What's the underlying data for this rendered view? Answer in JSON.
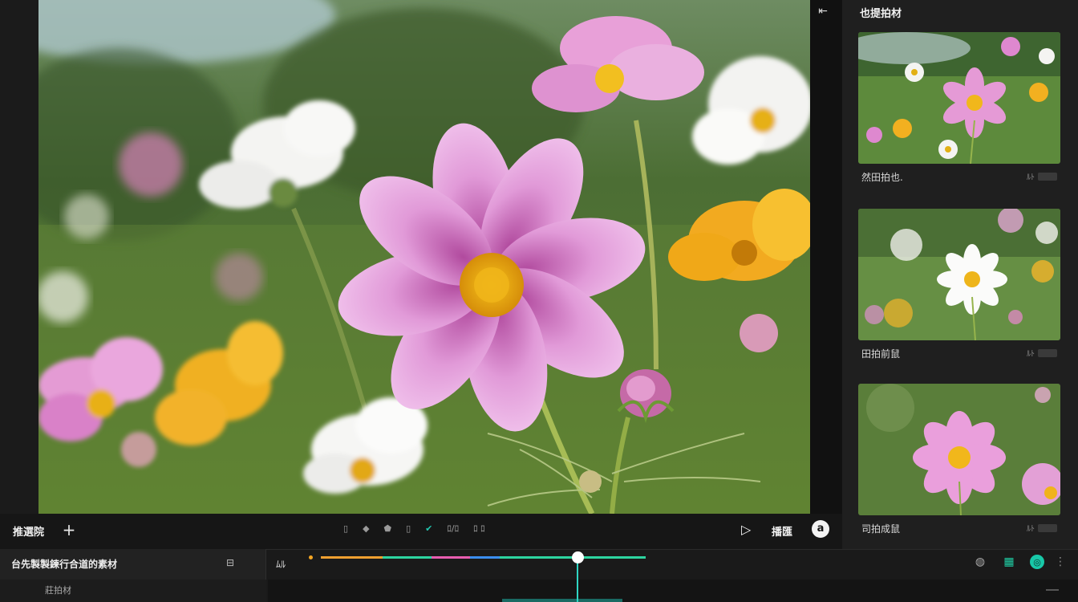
{
  "panel": {
    "title": "也提拍材",
    "collapse_icon": "collapse-icon",
    "cards": [
      {
        "label": "然田拍也.",
        "meta": "ﾙﾄ"
      },
      {
        "label": "田拍前鼠",
        "meta": "ﾙﾄ"
      },
      {
        "label": "司拍成鼠",
        "meta": "ﾙﾄ"
      }
    ]
  },
  "toolbar": {
    "label": "推選院",
    "add_icon": "+",
    "tools": [
      "▯",
      "◆",
      "⬟",
      "▯",
      "✔",
      "ﾛ/ﾛ",
      "ﾛ ﾛ"
    ],
    "play_icon": "▷",
    "export_label": "播匯",
    "logo_icon": "a"
  },
  "bottom": {
    "title": "台先製製鍊行合道的素材",
    "title_icon": "⊟",
    "sub": "莊拍材",
    "track_label": "ﾑﾙ",
    "timeline_segments": [
      {
        "color": "#f0a030",
        "share": 0.19
      },
      {
        "color": "#2dd4a0",
        "share": 0.15
      },
      {
        "color": "#e85db0",
        "share": 0.12
      },
      {
        "color": "#3b8ef0",
        "share": 0.09
      },
      {
        "color": "#2dd4a0",
        "share": 0.45
      }
    ],
    "playhead_fraction": 0.79,
    "right_icons": [
      "palette-icon",
      "grid-icon",
      "circle-icon",
      "more-icon"
    ]
  },
  "colors": {
    "accent": "#22c7b0",
    "background": "#151515",
    "panel": "#1f1f1f"
  }
}
